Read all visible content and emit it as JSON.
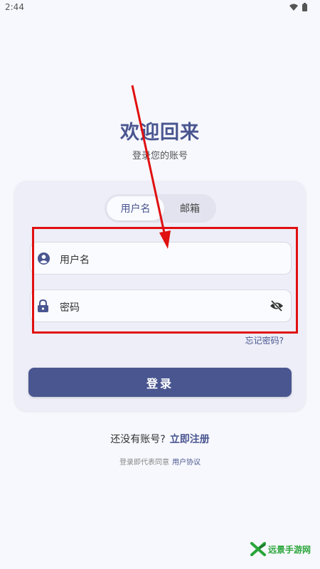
{
  "status_bar": {
    "time": "2:44",
    "icons": [
      "wifi-icon",
      "battery-icon"
    ]
  },
  "header": {
    "title": "欢迎回来",
    "subtitle": "登录您的账号"
  },
  "tabs": [
    {
      "label": "用户名",
      "active": true
    },
    {
      "label": "邮箱",
      "active": false
    }
  ],
  "form": {
    "username_label": "用户名",
    "password_label": "密码",
    "forgot_label": "忘记密码?",
    "login_label": "登录"
  },
  "footer": {
    "no_account_text": "还没有账号?",
    "register_label": "立即注册",
    "agreement_text": "登录即代表同意",
    "agreement_link": "用户协议"
  },
  "watermark": {
    "text": "远景手游网"
  },
  "colors": {
    "accent": "#4a5690",
    "background": "#f7f8fd",
    "card": "#edeef7",
    "annotation": "#e01010"
  }
}
